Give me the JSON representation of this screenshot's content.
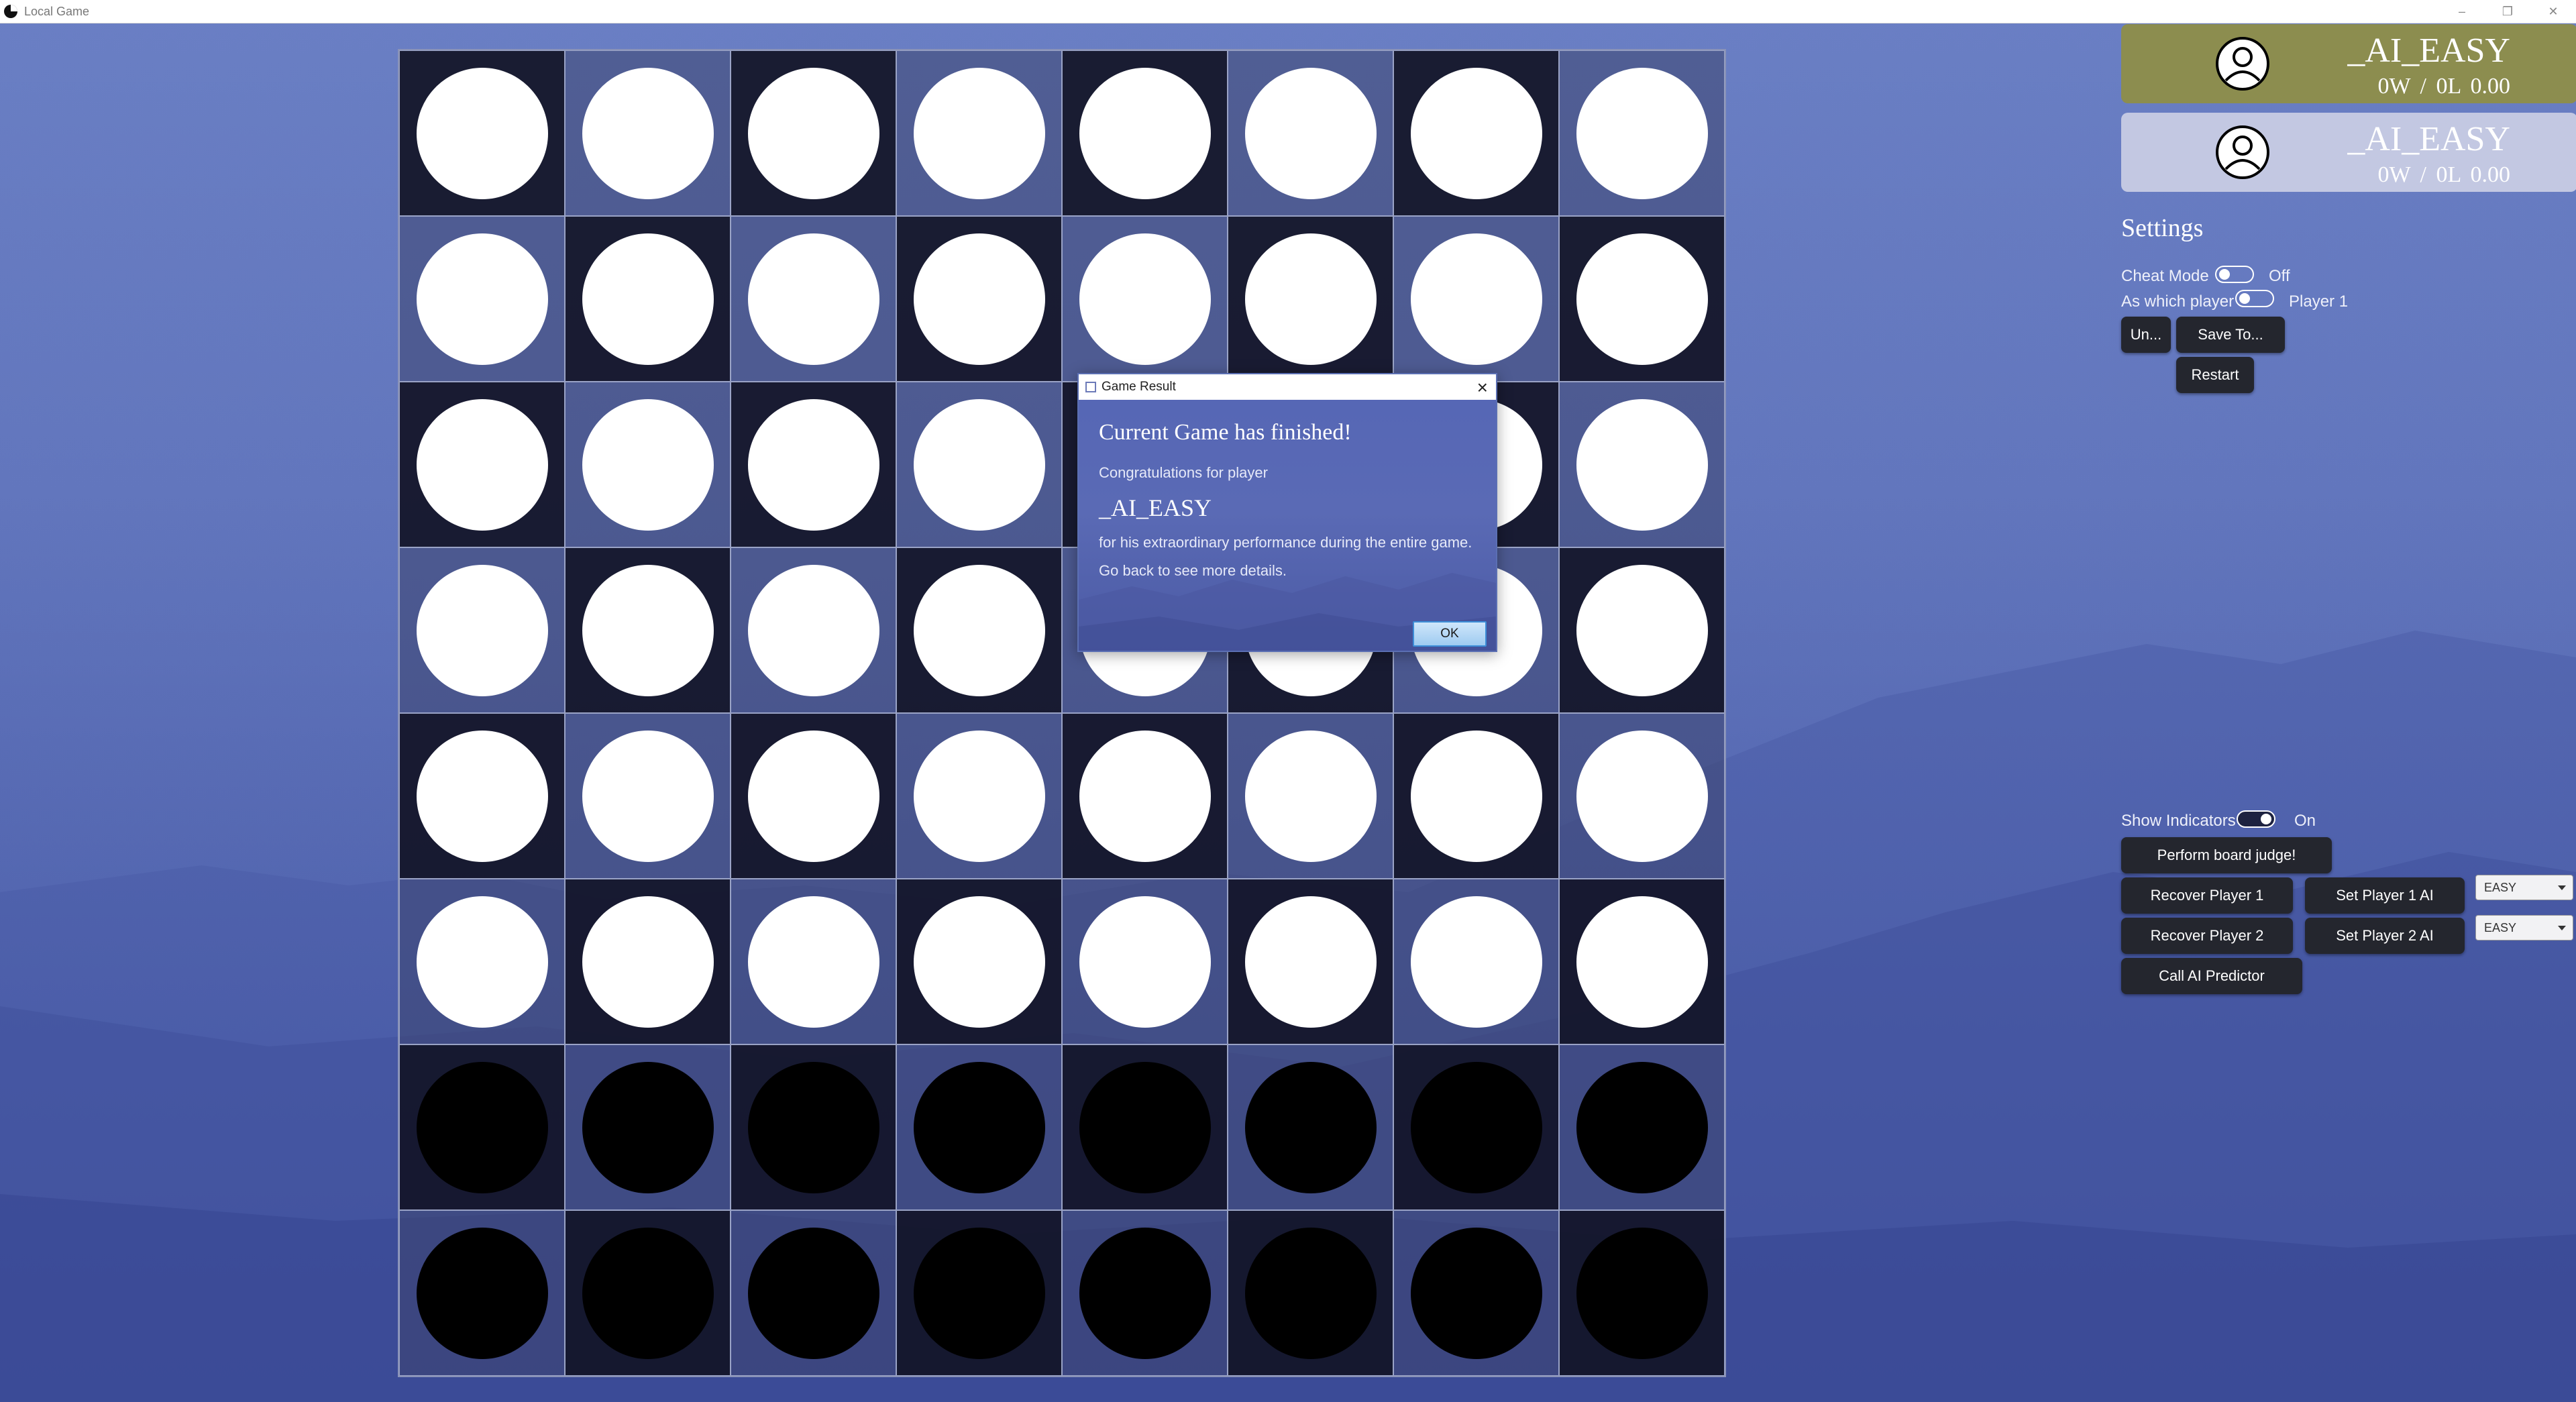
{
  "window": {
    "title": "Local Game",
    "controls": {
      "minimize": "–",
      "maximize": "❐",
      "close": "✕"
    }
  },
  "board": {
    "size": 8,
    "rows": [
      [
        "white",
        "white",
        "white",
        "white",
        "white",
        "white",
        "white",
        "white"
      ],
      [
        "white",
        "white",
        "white",
        "white",
        "white",
        "white",
        "white",
        "white"
      ],
      [
        "white",
        "white",
        "white",
        "white",
        "white",
        "white",
        "white",
        "white"
      ],
      [
        "white",
        "white",
        "white",
        "white",
        "white",
        "white",
        "white",
        "white"
      ],
      [
        "white",
        "white",
        "white",
        "white",
        "white",
        "white",
        "white",
        "white"
      ],
      [
        "white",
        "white",
        "white",
        "white",
        "white",
        "white",
        "white",
        "white"
      ],
      [
        "black",
        "black",
        "black",
        "black",
        "black",
        "black",
        "black",
        "black"
      ],
      [
        "black",
        "black",
        "black",
        "black",
        "black",
        "black",
        "black",
        "black"
      ]
    ]
  },
  "players": [
    {
      "name": "_AI_EASY",
      "wins": "0W /",
      "losses": "0L",
      "ratio": "0.00",
      "color": "#8c8d4f",
      "active": true
    },
    {
      "name": "_AI_EASY",
      "wins": "0W /",
      "losses": "0L",
      "ratio": "0.00",
      "color": "#c3c8e2",
      "active": false
    }
  ],
  "settings": {
    "title": "Settings",
    "cheat_mode": {
      "label": "Cheat Mode",
      "state": "Off"
    },
    "as_which_player": {
      "label": "As which player",
      "value": "Player 1"
    },
    "buttons": {
      "undo": "Un...",
      "save": "Save To...",
      "restart": "Restart"
    },
    "show_indicators": {
      "label": "Show Indicators",
      "state": "On"
    },
    "perform_judge": "Perform board judge!",
    "recover_p1": "Recover Player 1",
    "recover_p2": "Recover Player 2",
    "set_p1_ai": "Set Player 1 AI",
    "set_p2_ai": "Set Player 2 AI",
    "p1_ai_level": "EASY",
    "p2_ai_level": "EASY",
    "call_predictor": "Call AI Predictor"
  },
  "dialog": {
    "title": "Game Result",
    "heading": "Current Game has finished!",
    "congrats": "Congratulations for player",
    "winner": "_AI_EASY",
    "line1": "for his extraordinary performance during the entire game.",
    "line2": "Go back to see more details.",
    "ok": "OK"
  }
}
